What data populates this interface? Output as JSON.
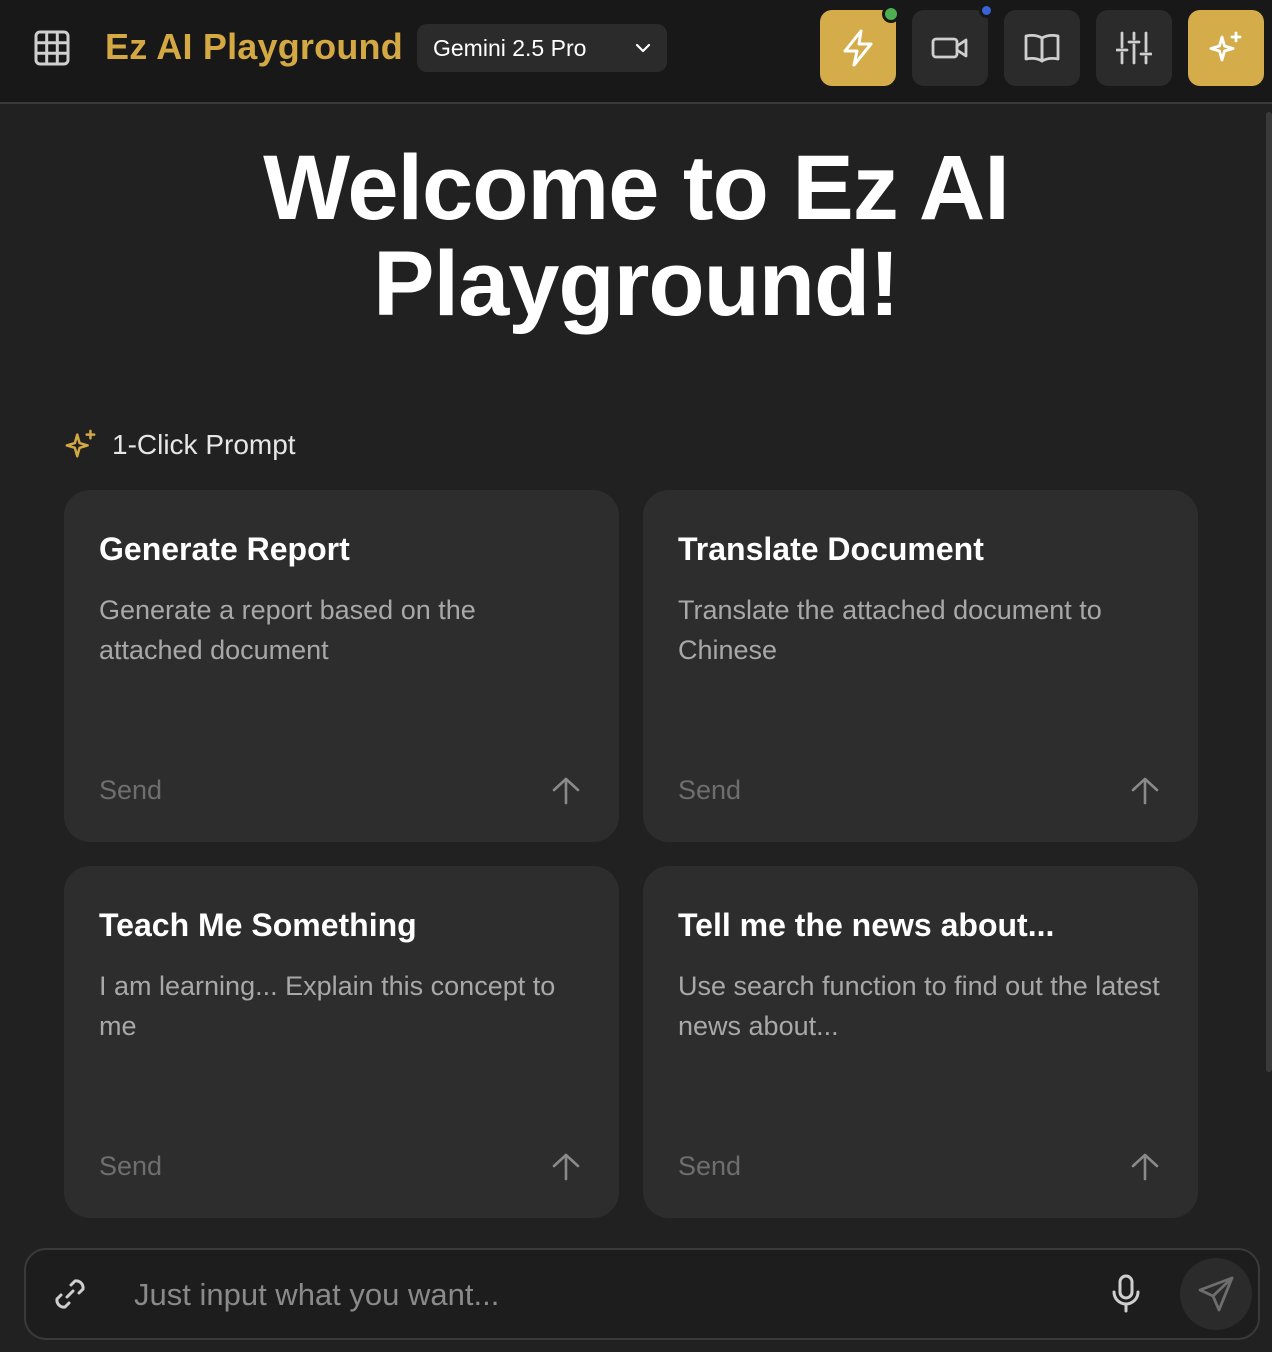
{
  "header": {
    "title": "Ez AI Playground",
    "model": "Gemini 2.5 Pro",
    "buttons": [
      {
        "name": "lightning-icon",
        "style": "gold",
        "status_dot": "#4caf50"
      },
      {
        "name": "video-camera-icon",
        "style": "dark",
        "status_dot": "#3b63d8"
      },
      {
        "name": "book-open-icon",
        "style": "dark"
      },
      {
        "name": "sliders-icon",
        "style": "dark"
      },
      {
        "name": "sparkles-icon",
        "style": "gold"
      }
    ]
  },
  "welcome": {
    "line1": "Welcome to Ez AI",
    "line2": "Playground!"
  },
  "prompts_section": {
    "label": "1-Click Prompt",
    "icon": "sparkles-icon"
  },
  "prompt_cards": [
    {
      "title": "Generate Report",
      "description": "Generate a report based on the attached document",
      "action": "Send"
    },
    {
      "title": "Translate Document",
      "description": "Translate the attached document to Chinese",
      "action": "Send"
    },
    {
      "title": "Teach Me Something",
      "description": "I am learning... Explain this concept to me",
      "action": "Send"
    },
    {
      "title": "Tell me the news about...",
      "description": "Use search function to find out the latest news about...",
      "action": "Send"
    }
  ],
  "composer": {
    "placeholder": "Just input what you want...",
    "value": ""
  },
  "colors": {
    "accent": "#d4a944",
    "background": "#212121",
    "card": "#2d2d2d"
  }
}
